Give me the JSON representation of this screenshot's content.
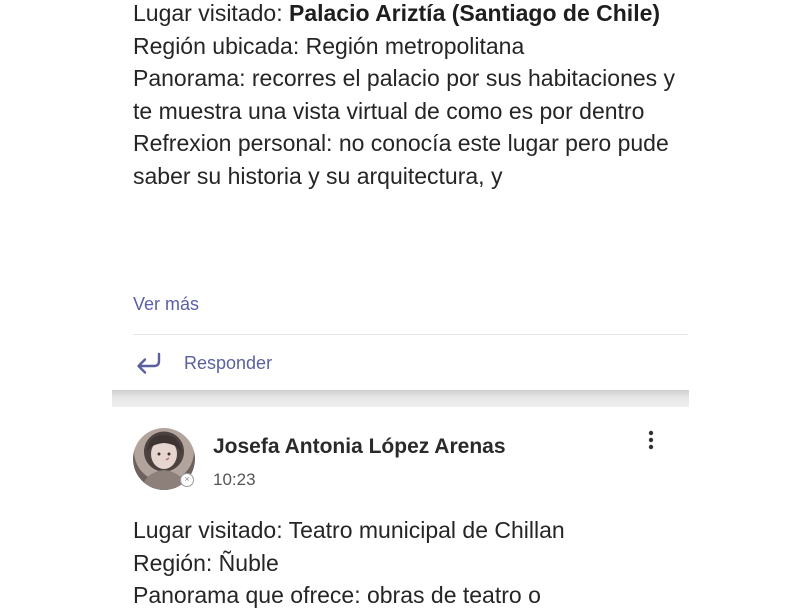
{
  "post1": {
    "lines": [
      {
        "label": "Lugar visitado: ",
        "value": "Palacio Ariztía (Santiago de Chile)"
      },
      {
        "text": "Región ubicada: Región metropolitana"
      },
      {
        "text": "Panorama: recorres el palacio por sus habitaciones y te muestra una vista virtual de como es por dentro"
      },
      {
        "text": "Refrexion personal: no conocía este lugar pero pude saber su historia y su arquitectura, y"
      }
    ],
    "see_more": "Ver más",
    "reply": "Responder"
  },
  "post2": {
    "author": "Josefa Antonia López Arenas",
    "time": "10:23",
    "lines": [
      {
        "text": "Lugar visitado: Teatro municipal de Chillan"
      },
      {
        "text": "Región: Ñuble"
      },
      {
        "text": "Panorama que ofrece: obras de teatro o"
      }
    ]
  },
  "icons": {
    "reply": "reply-arrow-icon",
    "more": "vertical-ellipsis-icon",
    "badge": "status-away-icon"
  },
  "colors": {
    "accent": "#5b5f9e",
    "text": "#252525",
    "separator": "#dcdcdc"
  }
}
